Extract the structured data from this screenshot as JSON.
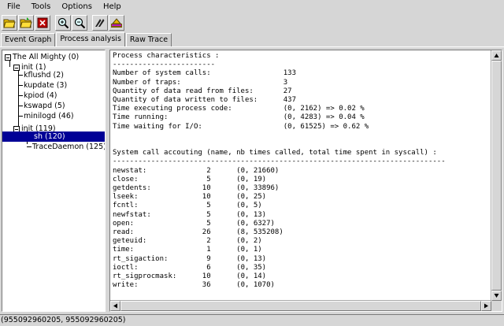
{
  "menubar": {
    "items": [
      "File",
      "Tools",
      "Options",
      "Help"
    ]
  },
  "toolbar": {
    "buttons": [
      "open-file-icon",
      "open-folder-icon",
      "close-file-icon",
      "zoom-in-icon",
      "zoom-out-icon",
      "show-more-icon",
      "show-less-icon"
    ]
  },
  "tabs": [
    {
      "label": "Event Graph",
      "active": false
    },
    {
      "label": "Process analysis",
      "active": true
    },
    {
      "label": "Raw Trace",
      "active": false
    }
  ],
  "tree": {
    "nodes": [
      {
        "label": "The All Mighty (0)",
        "expandable": true
      },
      {
        "label": "init (1)",
        "expandable": true
      },
      {
        "label": "kflushd (2)",
        "expandable": false
      },
      {
        "label": "kupdate (3)",
        "expandable": false
      },
      {
        "label": "kpiod (4)",
        "expandable": false
      },
      {
        "label": "kswapd (5)",
        "expandable": false
      },
      {
        "label": "minilogd (46)",
        "expandable": false
      },
      {
        "label": "init (119)",
        "expandable": true
      },
      {
        "label": "sh (120)",
        "expandable": false,
        "selected": true
      },
      {
        "label": "TraceDaemon (125)",
        "expandable": false
      }
    ]
  },
  "process_text": {
    "title": "Process characteristics :",
    "rule1": "------------------------",
    "stats": [
      {
        "label": "Number of system calls:",
        "value": "133"
      },
      {
        "label": "Number of traps:",
        "value": "3"
      },
      {
        "label": "Quantity of data read from files:",
        "value": "27"
      },
      {
        "label": "Quantity of data written to files:",
        "value": "437"
      },
      {
        "label": "Time executing process code:",
        "value": "(0, 2162) => 0.02 %"
      },
      {
        "label": "Time running:",
        "value": "(0, 4283) => 0.04 %"
      },
      {
        "label": "Time waiting for I/O:",
        "value": "(0, 61525) => 0.62 %"
      }
    ],
    "syscall_header": "System call accouting (name, nb times called, total time spent in syscall) :",
    "rule2": "------------------------------------------------------------------------------",
    "syscalls": [
      {
        "name": "newstat:",
        "count": "2",
        "time": "(0, 21660)"
      },
      {
        "name": "close:",
        "count": "5",
        "time": "(0, 19)"
      },
      {
        "name": "getdents:",
        "count": "10",
        "time": "(0, 33896)"
      },
      {
        "name": "lseek:",
        "count": "10",
        "time": "(0, 25)"
      },
      {
        "name": "fcntl:",
        "count": "5",
        "time": "(0, 5)"
      },
      {
        "name": "newfstat:",
        "count": "5",
        "time": "(0, 13)"
      },
      {
        "name": "open:",
        "count": "5",
        "time": "(0, 6327)"
      },
      {
        "name": "read:",
        "count": "26",
        "time": "(8, 535208)"
      },
      {
        "name": "geteuid:",
        "count": "2",
        "time": "(0, 2)"
      },
      {
        "name": "time:",
        "count": "1",
        "time": "(0, 1)"
      },
      {
        "name": "rt_sigaction:",
        "count": "9",
        "time": "(0, 13)"
      },
      {
        "name": "ioctl:",
        "count": "6",
        "time": "(0, 35)"
      },
      {
        "name": "rt_sigprocmask:",
        "count": "10",
        "time": "(0, 14)"
      },
      {
        "name": "write:",
        "count": "36",
        "time": "(0, 1070)"
      }
    ]
  },
  "statusbar": {
    "text": "(955092960205, 955092960205)"
  },
  "colors": {
    "chrome": "#d6d6d6",
    "selection": "#000096"
  }
}
